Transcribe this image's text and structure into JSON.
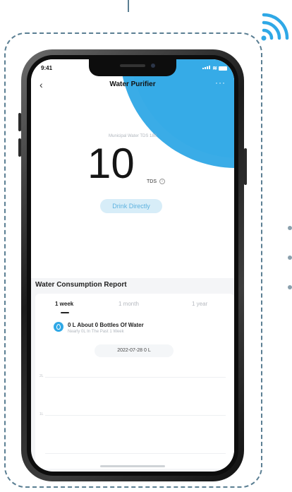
{
  "colors": {
    "accent": "#2fa8e6",
    "frame": "#5b7f93",
    "pill_bg": "#d7edf8",
    "pill_text": "#5eb2df"
  },
  "status_bar": {
    "time": "9:41"
  },
  "nav": {
    "back_icon": "chevron-left-icon",
    "title": "Water Purifier",
    "more_label": "···"
  },
  "hero": {
    "subtitle": "Municipal Water TDS 180",
    "tds_value": "10",
    "tds_unit": "TDS",
    "info_icon": "info-icon",
    "button_label": "Drink Directly"
  },
  "report": {
    "title": "Water Consumption Report",
    "tabs": [
      {
        "label": "1 week",
        "active": true
      },
      {
        "label": "1 month",
        "active": false
      },
      {
        "label": "1 year",
        "active": false
      }
    ],
    "summary": "0 L About 0 Bottles Of Water",
    "summary_sub": "Nearly 0L In The Past 1 Week",
    "date_label": "2022-07-28 0 L",
    "y_labels": [
      "2L",
      "1L"
    ]
  }
}
